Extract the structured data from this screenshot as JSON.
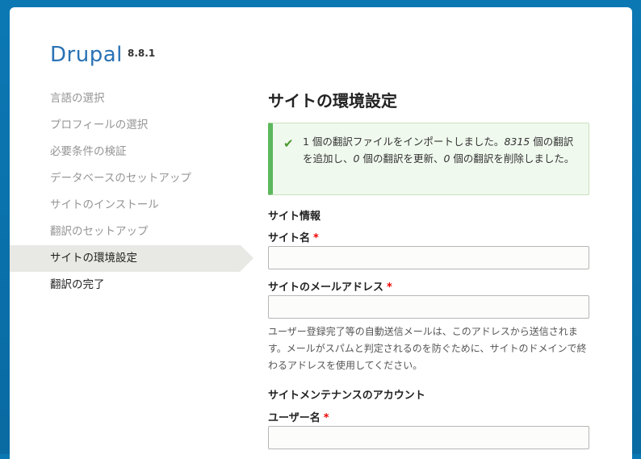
{
  "brand": {
    "name": "Drupal",
    "version": "8.8.1"
  },
  "steps": [
    {
      "label": "言語の選択",
      "state": "done"
    },
    {
      "label": "プロフィールの選択",
      "state": "done"
    },
    {
      "label": "必要条件の検証",
      "state": "done"
    },
    {
      "label": "データベースのセットアップ",
      "state": "done"
    },
    {
      "label": "サイトのインストール",
      "state": "done"
    },
    {
      "label": "翻訳のセットアップ",
      "state": "done"
    },
    {
      "label": "サイトの環境設定",
      "state": "active"
    },
    {
      "label": "翻訳の完了",
      "state": "todo"
    }
  ],
  "main": {
    "title": "サイトの環境設定",
    "message": {
      "t1": "1 個の翻訳ファイルをインポートしました。",
      "n1": "8315",
      "t2": " 個の翻訳を追加し、",
      "n2": "0",
      "t3": " 個の翻訳を更新、",
      "n3": "0",
      "t4": " 個の翻訳を削除しました。"
    },
    "site_info": {
      "heading": "サイト情報",
      "site_name_label": "サイト名",
      "site_name_value": "",
      "site_mail_label": "サイトのメールアドレス",
      "site_mail_value": "",
      "site_mail_desc": "ユーザー登録完了等の自動送信メールは、このアドレスから送信されます。メールがスパムと判定されるのを防ぐために、サイトのドメインで終わるアドレスを使用してください。"
    },
    "account": {
      "heading": "サイトメンテナンスのアカウント",
      "username_label": "ユーザー名",
      "username_value": ""
    },
    "required_mark": "*"
  }
}
